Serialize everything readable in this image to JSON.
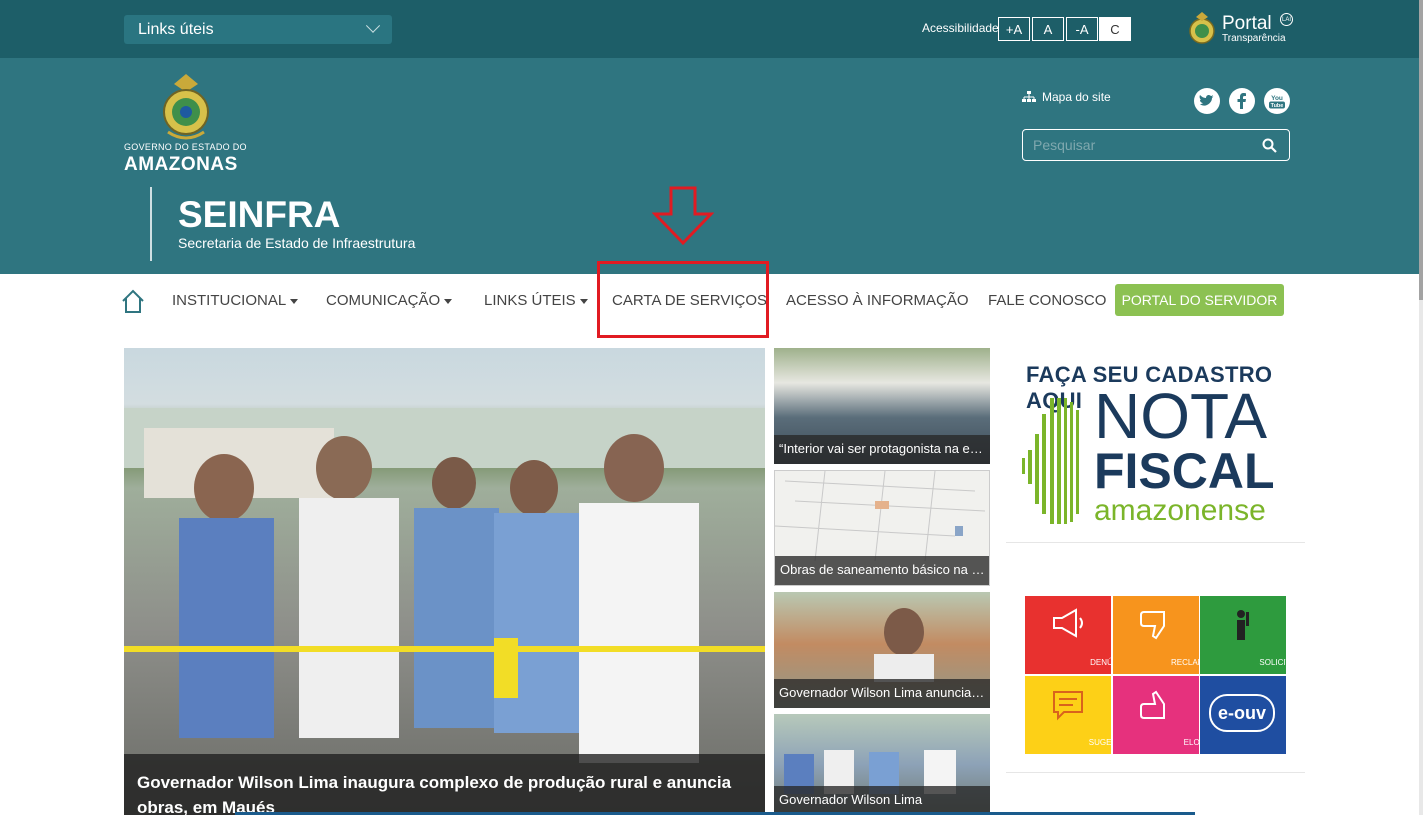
{
  "topbar": {
    "links_select": "Links úteis",
    "accessibility_label": "Acessibilidade",
    "acc_buttons": [
      "+A",
      "A",
      "-A",
      "C"
    ],
    "portal_title": "Portal",
    "portal_sub": "Transparência",
    "portal_badge": "LAI"
  },
  "header": {
    "gov_small": "GOVERNO DO ESTADO DO",
    "gov_big": "AMAZONAS",
    "org_title": "SEINFRA",
    "org_subtitle": "Secretaria de Estado de Infraestrutura",
    "sitemap": "Mapa do site",
    "social": [
      "twitter-icon",
      "facebook-icon",
      "youtube-icon"
    ],
    "search_placeholder": "Pesquisar"
  },
  "nav": {
    "items": [
      "INSTITUCIONAL",
      "COMUNICAÇÃO",
      "LINKS ÚTEIS",
      "CARTA DE SERVIÇOS",
      "ACESSO À INFORMAÇÃO",
      "FALE CONOSCO"
    ],
    "servidor": "PORTAL DO SERVIDOR"
  },
  "hero": {
    "caption": "Governador Wilson Lima inaugura complexo de produção rural e anuncia obras, em Maués"
  },
  "news": [
    {
      "caption": "“Interior vai ser protagonista na execução de obras”"
    },
    {
      "caption": "Obras de saneamento básico na beira-rio"
    },
    {
      "caption": "Governador Wilson Lima anuncia obras"
    },
    {
      "caption": "Governador Wilson Lima"
    }
  ],
  "nota": {
    "top": "FAÇA SEU CADASTRO AQUI",
    "nota": "NOTA",
    "fiscal": "FISCAL",
    "amazonense": "amazonense"
  },
  "tiles": [
    {
      "label": "DENÚNCIA",
      "color": "#e8312f"
    },
    {
      "label": "RECLAMAÇÃO",
      "color": "#f7941d"
    },
    {
      "label": "SOLICITAÇÃO",
      "color": "#2e9b3e"
    },
    {
      "label": "SUGESTÃO",
      "color": "#fdd017"
    },
    {
      "label": "ELOGIO",
      "color": "#e6317d"
    },
    {
      "label": "e-ouv",
      "color": "#1f4ea1"
    }
  ],
  "colors": {
    "topbar": "#1d5e68",
    "header": "#2f7580",
    "accent_green": "#8cc152",
    "highlight_red": "#e11b22"
  }
}
